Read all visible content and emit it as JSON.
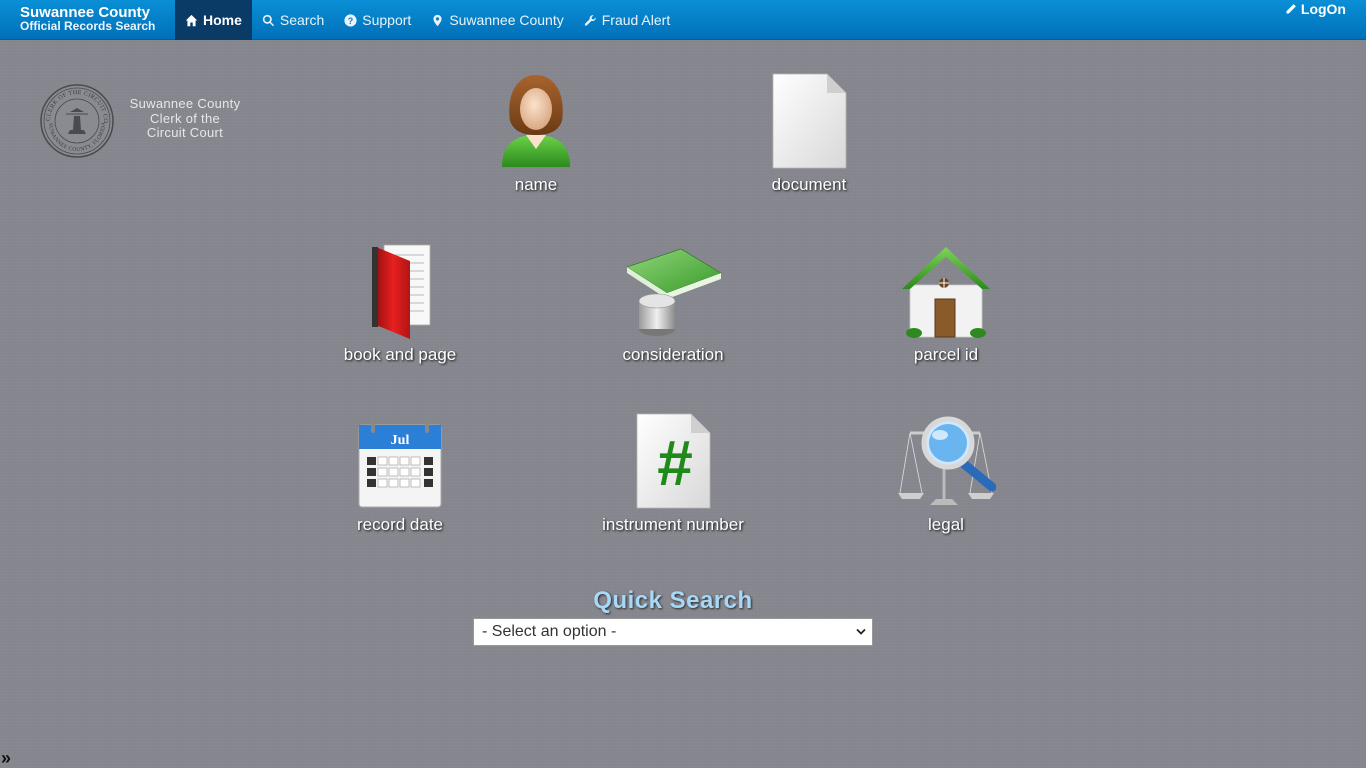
{
  "brand": {
    "line1": "Suwannee County",
    "line2": "Official Records Search"
  },
  "nav": {
    "home": "Home",
    "search": "Search",
    "support": "Support",
    "county": "Suwannee County",
    "fraud": "Fraud Alert",
    "logon": "LogOn"
  },
  "logo": {
    "line1": "Suwannee County",
    "line2": "Clerk of the",
    "line3": "Circuit Court",
    "seal_text_top": "CLERK OF THE CIRCUIT COURT",
    "seal_text_bottom": "SUWANNEE COUNTY, FLORIDA"
  },
  "tiles": {
    "name": "name",
    "document": "document",
    "book": "book and page",
    "consideration": "consideration",
    "parcel": "parcel id",
    "record_date": "record date",
    "calendar_month": "Jul",
    "instrument": "instrument number",
    "legal": "legal"
  },
  "quick_search": {
    "title": "Quick Search",
    "selected": "- Select an option -"
  },
  "toggle": "»"
}
